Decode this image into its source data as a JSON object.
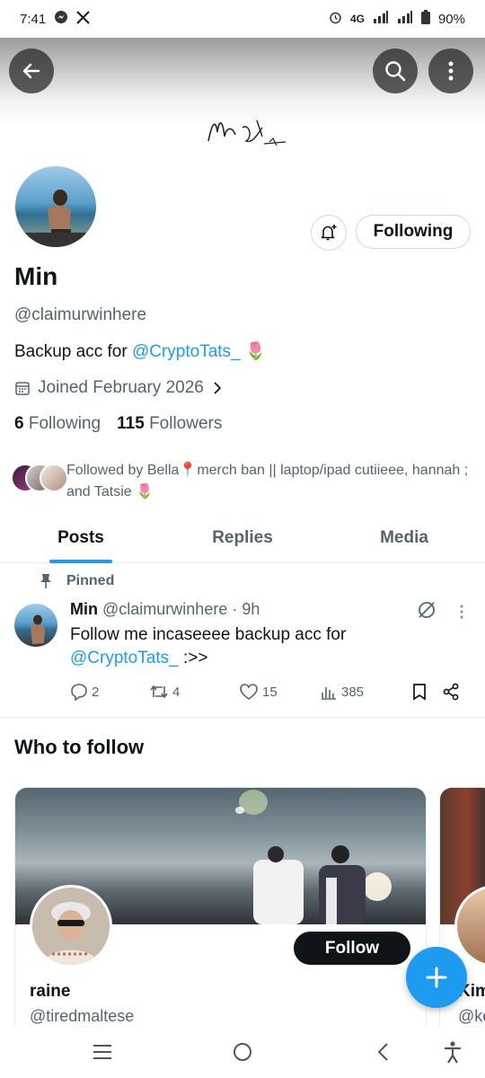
{
  "status_bar": {
    "time": "7:41",
    "network": "4G",
    "battery": "90%"
  },
  "profile": {
    "name": "Min",
    "handle": "@claimurwinhere",
    "bio_text": "Backup acc for ",
    "bio_mention": "@CryptoTats_",
    "bio_emoji": "🌷",
    "joined": "Joined February 2026",
    "following_count": "6",
    "following_label": "Following",
    "followers_count": "115",
    "followers_label": "Followers",
    "followed_by": "Followed by Bella📍merch ban || laptop/ipad cutiieee, hannah ; and Tatsie 🌷",
    "following_button": "Following"
  },
  "tabs": [
    {
      "label": "Posts",
      "active": true
    },
    {
      "label": "Replies",
      "active": false
    },
    {
      "label": "Media",
      "active": false
    }
  ],
  "pinned_post": {
    "pinned_label": "Pinned",
    "author_name": "Min",
    "author_handle": "@claimurwinhere",
    "time": "· 9h",
    "text_before": "Follow me incaseeee backup acc for",
    "mention": "@CryptoTats_",
    "text_after": " :>>",
    "replies": "2",
    "reposts": "4",
    "likes": "15",
    "views": "385"
  },
  "who_to_follow": {
    "title": "Who to follow",
    "cards": [
      {
        "name": "raine",
        "handle": "@tiredmaltese",
        "button": "Follow"
      },
      {
        "name": "Kim",
        "handle": "@ke"
      }
    ]
  },
  "colors": {
    "accent": "#1d9bf0",
    "text": "#0f1419",
    "secondary": "#536471"
  }
}
